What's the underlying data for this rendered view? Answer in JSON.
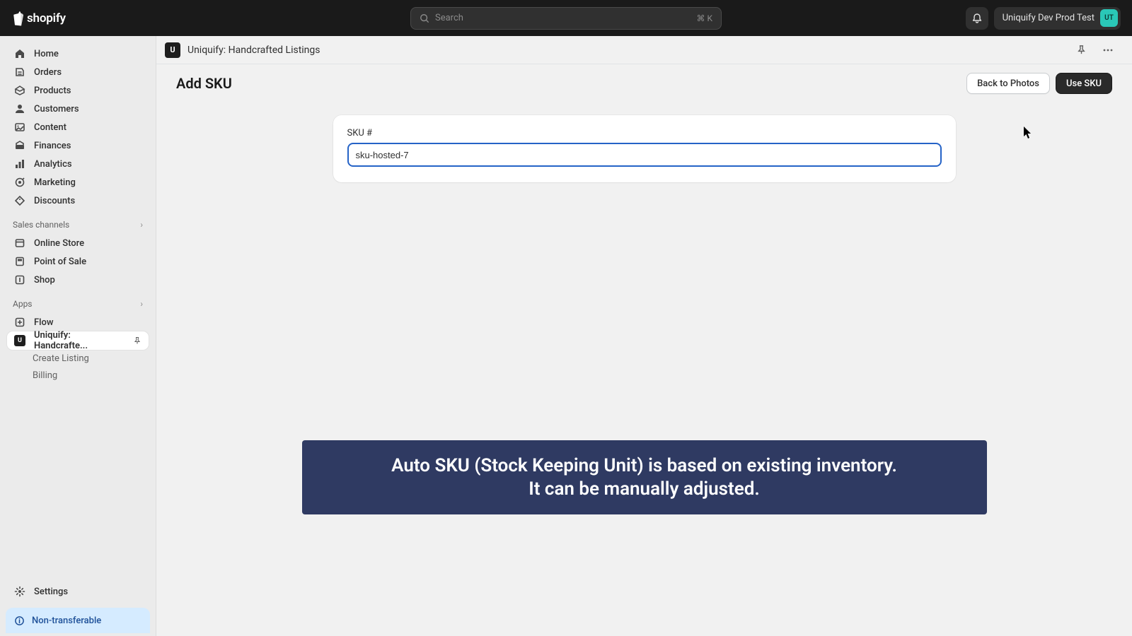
{
  "brand": "shopify",
  "search": {
    "placeholder": "Search",
    "shortcut": "⌘ K"
  },
  "store": {
    "name": "Uniquify Dev Prod Test",
    "initials": "UT"
  },
  "sidebar": {
    "primary": [
      {
        "label": "Home",
        "icon": "home-icon"
      },
      {
        "label": "Orders",
        "icon": "orders-icon"
      },
      {
        "label": "Products",
        "icon": "products-icon"
      },
      {
        "label": "Customers",
        "icon": "customers-icon"
      },
      {
        "label": "Content",
        "icon": "content-icon"
      },
      {
        "label": "Finances",
        "icon": "finances-icon"
      },
      {
        "label": "Analytics",
        "icon": "analytics-icon"
      },
      {
        "label": "Marketing",
        "icon": "marketing-icon"
      },
      {
        "label": "Discounts",
        "icon": "discounts-icon"
      }
    ],
    "sections": {
      "sales_channels": {
        "label": "Sales channels"
      },
      "apps": {
        "label": "Apps"
      }
    },
    "channels": [
      {
        "label": "Online Store"
      },
      {
        "label": "Point of Sale"
      },
      {
        "label": "Shop"
      }
    ],
    "apps": [
      {
        "label": "Flow"
      },
      {
        "label": "Uniquify: Handcrafte...",
        "active": true,
        "children": [
          {
            "label": "Create Listing"
          },
          {
            "label": "Billing"
          }
        ]
      }
    ],
    "settings_label": "Settings",
    "partner_badge": "Non-transferable"
  },
  "app_bar": {
    "title": "Uniquify: Handcrafted Listings",
    "icon_text": "U"
  },
  "page": {
    "title": "Add SKU",
    "back_button": "Back to Photos",
    "primary_button": "Use SKU",
    "sku_label": "SKU #",
    "sku_value": "sku-hosted-7",
    "banner_line1": "Auto SKU (Stock Keeping Unit) is based on existing inventory.",
    "banner_line2": "It can be manually adjusted."
  }
}
